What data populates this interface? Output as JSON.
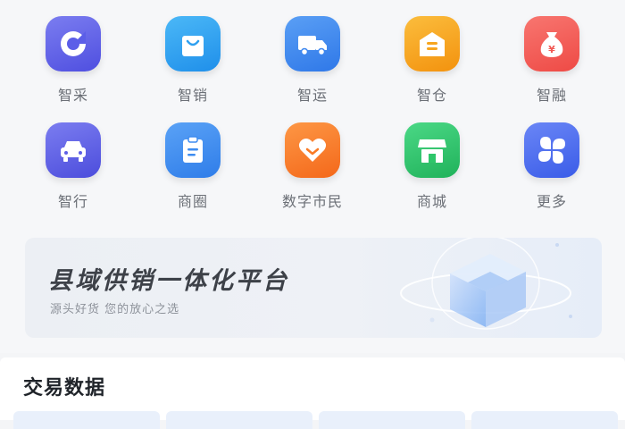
{
  "services": {
    "row1": [
      {
        "label": "智采",
        "icon": "zhicai-icon"
      },
      {
        "label": "智销",
        "icon": "shopping-bag-icon"
      },
      {
        "label": "智运",
        "icon": "truck-icon"
      },
      {
        "label": "智仓",
        "icon": "warehouse-icon"
      },
      {
        "label": "智融",
        "icon": "money-bag-icon"
      }
    ],
    "row2": [
      {
        "label": "智行",
        "icon": "car-icon"
      },
      {
        "label": "商圈",
        "icon": "clipboard-icon"
      },
      {
        "label": "数字市民",
        "icon": "heart-icon"
      },
      {
        "label": "商城",
        "icon": "storefront-icon"
      },
      {
        "label": "更多",
        "icon": "four-leaf-icon"
      }
    ]
  },
  "banner": {
    "title": "县域供销一体化平台",
    "subtitle": "源头好货 您的放心之选"
  },
  "trade_section": {
    "title": "交易数据"
  },
  "colors": {
    "zhicai": "#5b5ee8",
    "zhixiao": "#2fa0f0",
    "zhiyun": "#3c86ef",
    "zhicang": "#f7a51e",
    "zhirong": "#f25a55",
    "zhixing": "#5d5fe6",
    "shangquan": "#3d8cf0",
    "shimin": "#f97a25",
    "shangcheng": "#2ec66a",
    "more": "#4a6cf0"
  }
}
